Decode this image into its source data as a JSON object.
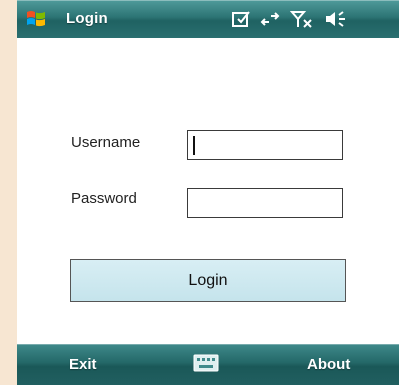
{
  "titlebar": {
    "title": "Login",
    "icons": [
      "windows-start-icon",
      "notes-icon",
      "connectivity-icon",
      "signal-off-icon",
      "volume-icon"
    ]
  },
  "form": {
    "username_label": "Username",
    "username_value": "",
    "password_label": "Password",
    "password_value": "",
    "login_label": "Login"
  },
  "softbar": {
    "left_label": "Exit",
    "right_label": "About",
    "center_icon": "keyboard-icon"
  },
  "colors": {
    "bar_teal": "#2c7474",
    "button_fill": "#c5e4ec",
    "background": "#ffffff"
  }
}
